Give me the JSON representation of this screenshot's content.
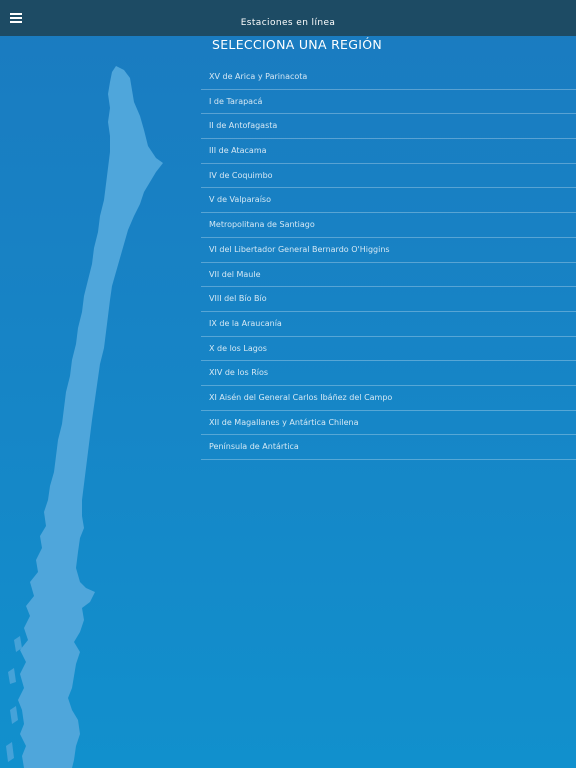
{
  "header": {
    "title": "Estaciones en línea",
    "menu_icon": "hamburger-menu-icon"
  },
  "page": {
    "title": "SELECCIONA UNA REGIÓN"
  },
  "map": {
    "icon": "chile-map-icon",
    "color": "#4fa6db"
  },
  "regions": [
    "XV de Arica y Parinacota",
    "I de Tarapacá",
    "II de Antofagasta",
    "III de Atacama",
    "IV de Coquimbo",
    "V de Valparaíso",
    "Metropolitana de Santiago",
    "VI del Libertador General Bernardo O'Higgins",
    "VII del Maule",
    "VIII del Bío Bío",
    "IX de la Araucanía",
    "X de los Lagos",
    "XIV de los Ríos",
    "XI Aisén del General Carlos Ibáñez del Campo",
    "XII de Magallanes y Antártica Chilena",
    "Península de Antártica"
  ],
  "colors": {
    "topbar": "#1d4b64",
    "background": "#1686c7",
    "text": "#ffffff"
  }
}
